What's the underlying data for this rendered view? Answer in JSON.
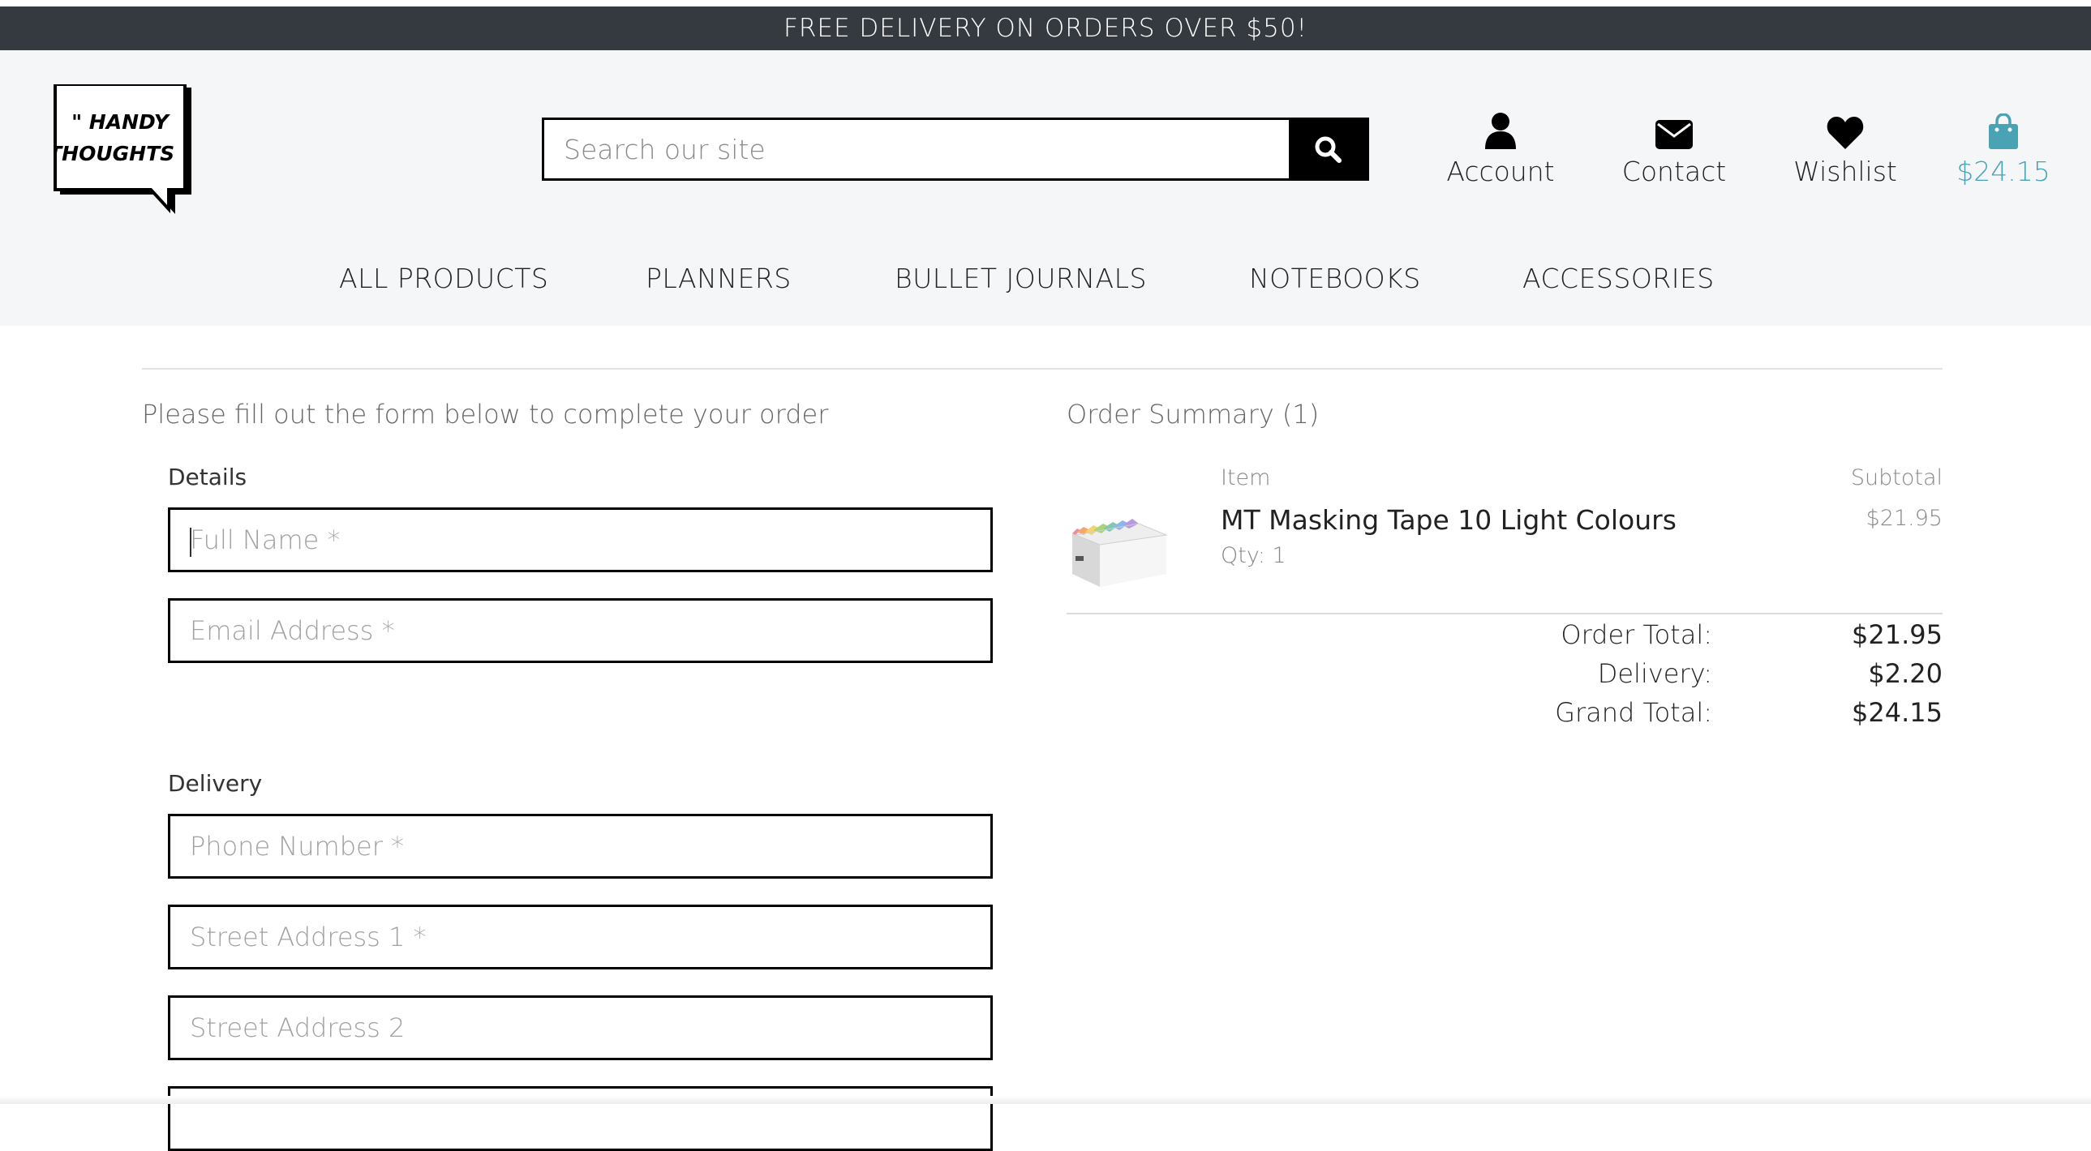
{
  "banner": {
    "text": "FREE DELIVERY ON ORDERS OVER $50!"
  },
  "logo": {
    "line1": "\" HANDY",
    "line2": "THOUGHTS \""
  },
  "search": {
    "placeholder": "Search our site"
  },
  "header_links": [
    {
      "label": "Account",
      "icon": "user-icon"
    },
    {
      "label": "Contact",
      "icon": "envelope-icon"
    },
    {
      "label": "Wishlist",
      "icon": "heart-icon"
    },
    {
      "label": "$24.15",
      "icon": "shopping-bag-icon"
    }
  ],
  "menu": [
    "ALL PRODUCTS",
    "PLANNERS",
    "BULLET JOURNALS",
    "NOTEBOOKS",
    "ACCESSORIES"
  ],
  "checkout": {
    "intro": "Please fill out the form below to complete your order",
    "details_label": "Details",
    "delivery_label": "Delivery",
    "fields": {
      "full_name": "Full Name *",
      "email": "Email Address *",
      "phone": "Phone Number *",
      "street1": "Street Address 1 *",
      "street2": "Street Address 2"
    }
  },
  "summary": {
    "title": "Order Summary (1)",
    "col_item": "Item",
    "col_subtotal": "Subtotal",
    "product": {
      "name": "MT Masking Tape 10 Light Colours",
      "qty": "Qty: 1",
      "subtotal": "$21.95"
    },
    "order_total_label": "Order Total:",
    "order_total": "$21.95",
    "delivery_label": "Delivery:",
    "delivery": "$2.20",
    "grand_total_label": "Grand Total:",
    "grand_total": "$24.15"
  },
  "colors": {
    "banner_bg": "#343a40",
    "header_bg": "#f5f6f8",
    "accent": "#4aa3b5"
  }
}
